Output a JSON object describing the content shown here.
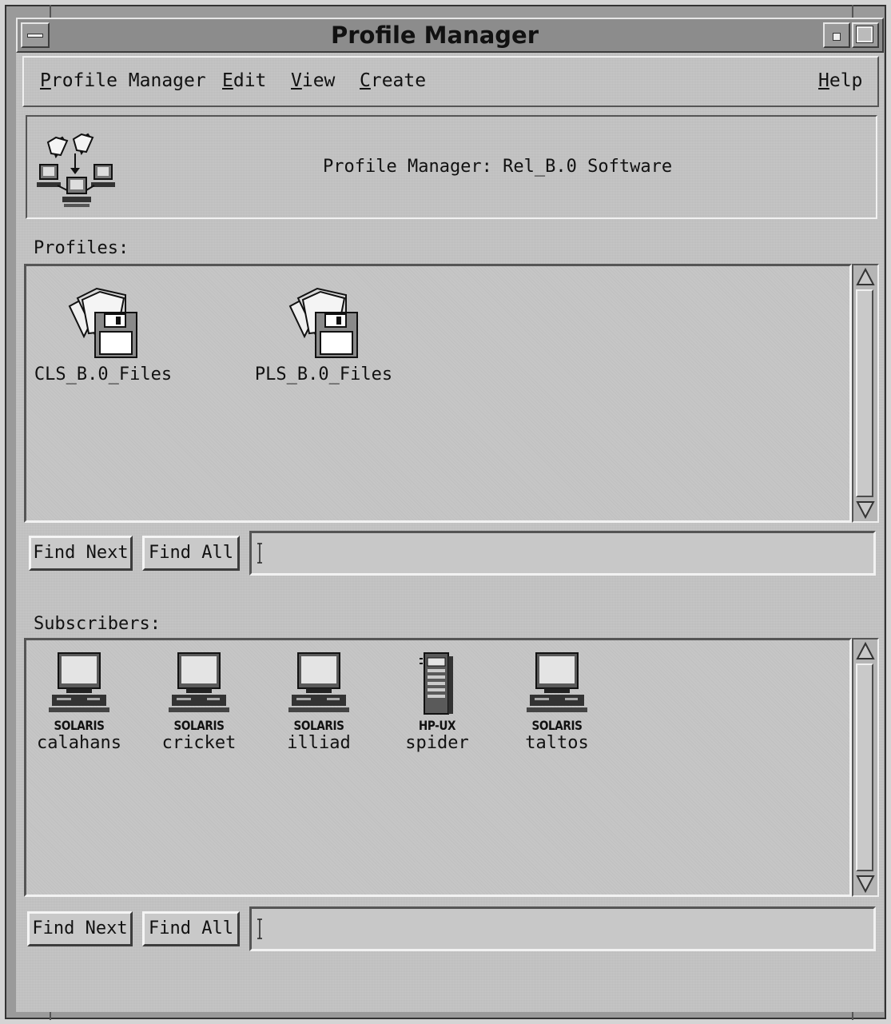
{
  "window": {
    "title": "Profile Manager"
  },
  "menubar": {
    "items": [
      {
        "first": "P",
        "rest": "rofile Manager"
      },
      {
        "first": "E",
        "rest": "dit"
      },
      {
        "first": "V",
        "rest": "iew"
      },
      {
        "first": "C",
        "rest": "reate"
      }
    ],
    "help": {
      "first": "H",
      "rest": "elp"
    }
  },
  "header": {
    "text": "Profile Manager: Rel_B.0 Software",
    "icon": "profile-manager-icon"
  },
  "profiles": {
    "label": "Profiles:",
    "items": [
      {
        "name": "CLS_B.0_Files",
        "icon": "file-package-icon"
      },
      {
        "name": "PLS_B.0_Files",
        "icon": "file-package-icon"
      }
    ],
    "find_next": "Find Next",
    "find_all": "Find All",
    "search_value": ""
  },
  "subscribers": {
    "label": "Subscribers:",
    "items": [
      {
        "os": "SOLARIS",
        "host": "calahans",
        "icon": "workstation-icon"
      },
      {
        "os": "SOLARIS",
        "host": "cricket",
        "icon": "workstation-icon"
      },
      {
        "os": "SOLARIS",
        "host": "illiad",
        "icon": "workstation-icon"
      },
      {
        "os": "HP-UX",
        "host": "spider",
        "icon": "server-tower-icon"
      },
      {
        "os": "SOLARIS",
        "host": "taltos",
        "icon": "workstation-icon"
      }
    ],
    "find_next": "Find Next",
    "find_all": "Find All",
    "search_value": ""
  }
}
